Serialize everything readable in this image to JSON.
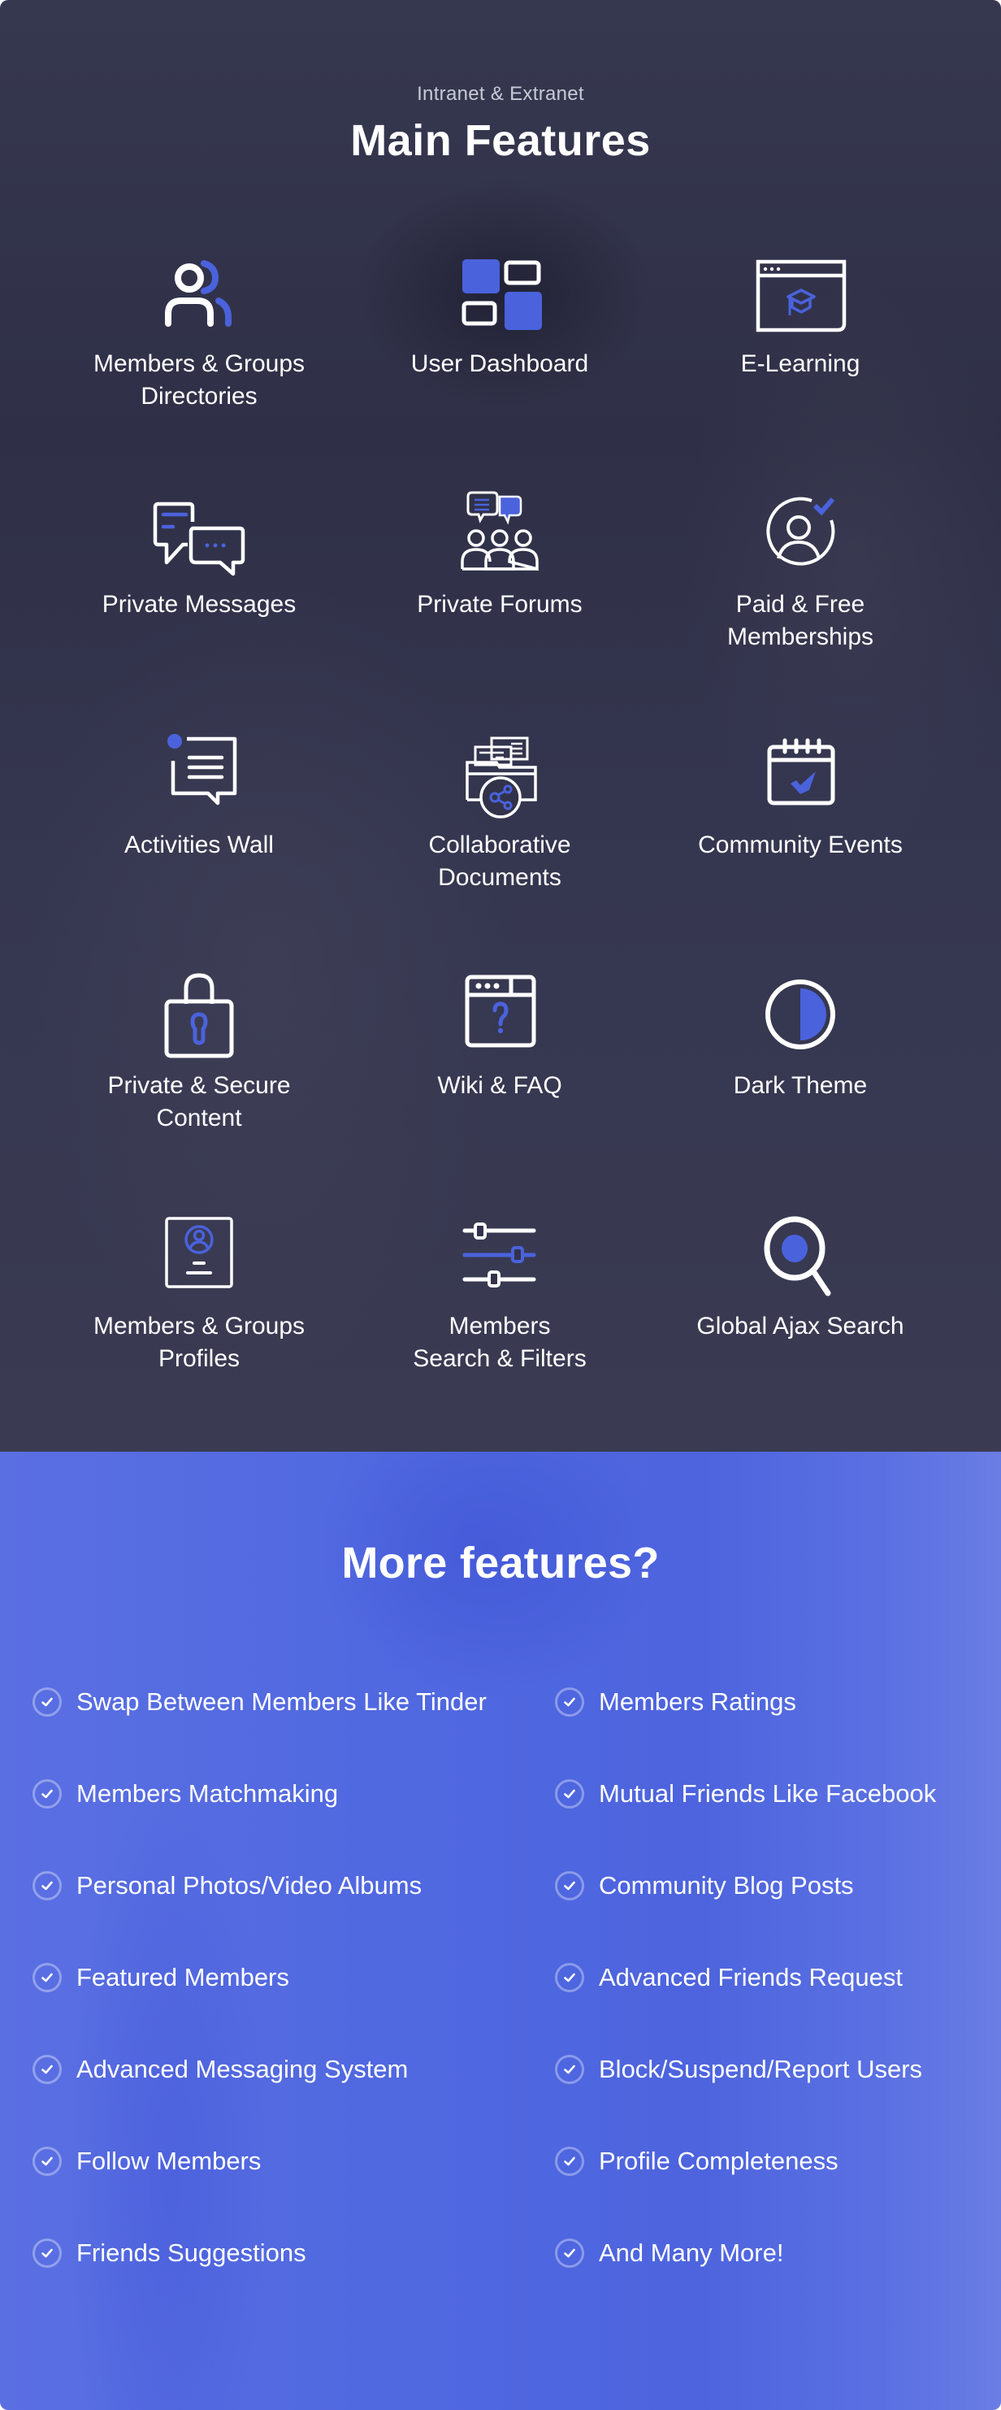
{
  "colors": {
    "accent": "#4a62dc",
    "icon_white": "#ffffff",
    "dark_bg": "#32334a",
    "blue_bg": "#5068e0"
  },
  "main_section": {
    "eyebrow": "Intranet & Extranet",
    "title": "Main Features",
    "features": [
      {
        "icon": "members-groups-icon",
        "label": "Members & Groups\nDirectories"
      },
      {
        "icon": "dashboard-icon",
        "label": "User Dashboard"
      },
      {
        "icon": "elearning-icon",
        "label": "E-Learning"
      },
      {
        "icon": "private-messages-icon",
        "label": "Private Messages"
      },
      {
        "icon": "forums-icon",
        "label": "Private Forums"
      },
      {
        "icon": "membership-icon",
        "label": "Paid & Free\nMemberships"
      },
      {
        "icon": "activity-wall-icon",
        "label": "Activities Wall"
      },
      {
        "icon": "shared-documents-icon",
        "label": "Collaborative\nDocuments"
      },
      {
        "icon": "calendar-check-icon",
        "label": "Community Events"
      },
      {
        "icon": "padlock-icon",
        "label": "Private & Secure\nContent"
      },
      {
        "icon": "faq-window-icon",
        "label": "Wiki  & FAQ"
      },
      {
        "icon": "dark-theme-icon",
        "label": "Dark Theme"
      },
      {
        "icon": "profile-card-icon",
        "label": "Members & Groups\nProfiles"
      },
      {
        "icon": "filter-sliders-icon",
        "label": "Members\nSearch & Filters"
      },
      {
        "icon": "search-icon",
        "label": "Global Ajax Search"
      }
    ]
  },
  "more_section": {
    "title": "More features?",
    "items": [
      "Swap Between Members Like Tinder",
      "Members Ratings",
      "Members Matchmaking",
      "Mutual Friends Like Facebook",
      "Personal Photos/Video Albums",
      "Community Blog Posts",
      "Featured Members",
      "Advanced Friends Request",
      "Advanced Messaging System",
      "Block/Suspend/Report Users",
      "Follow Members",
      "Profile Completeness",
      "Friends Suggestions",
      "And Many More!"
    ]
  }
}
